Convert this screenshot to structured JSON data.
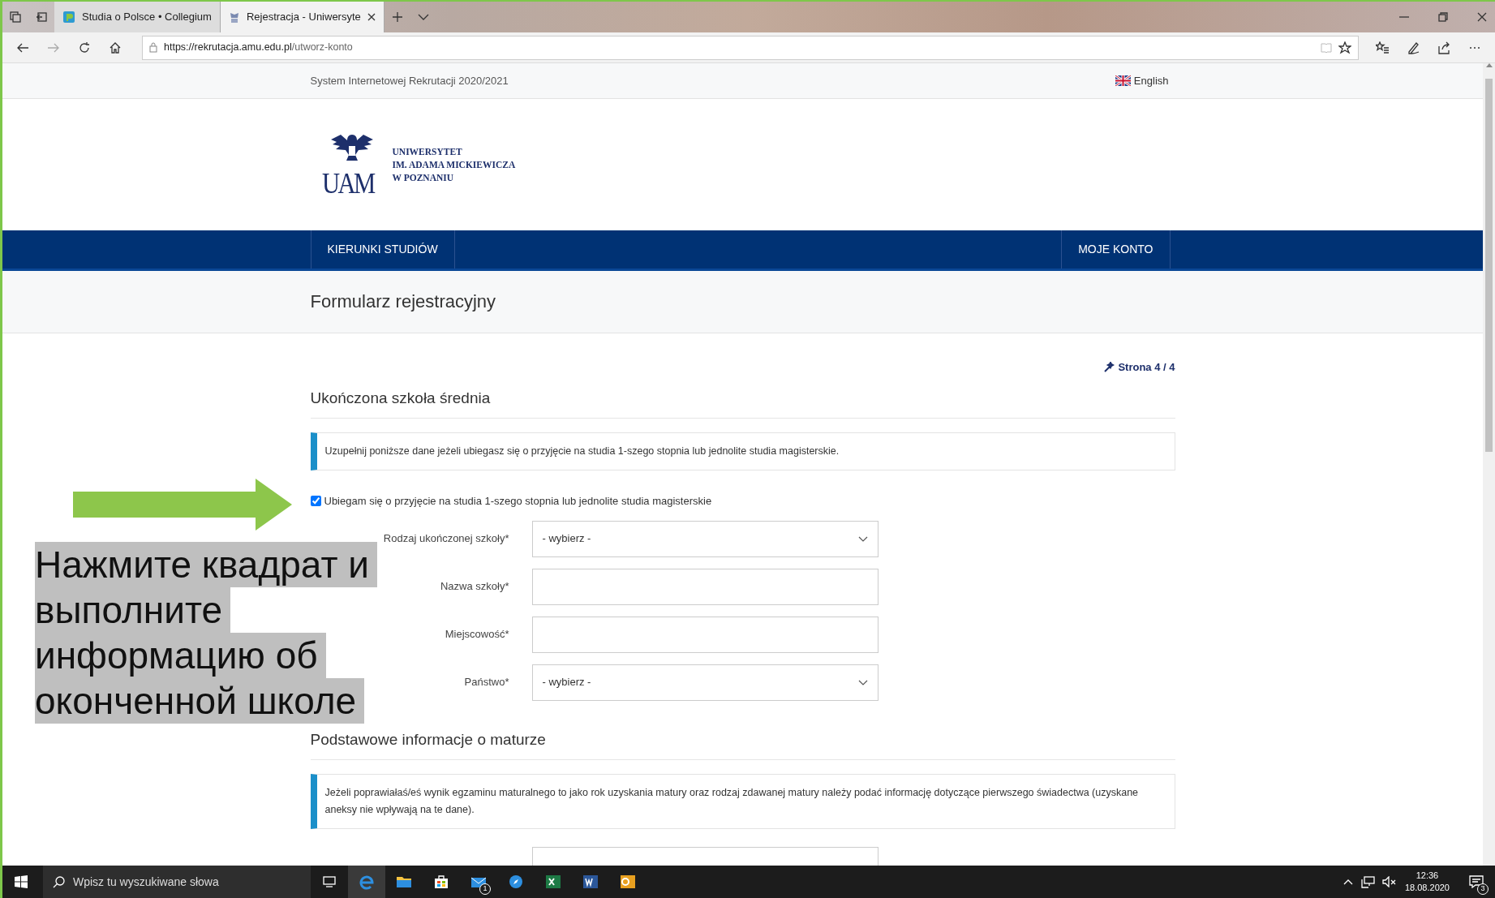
{
  "browser": {
    "tabs": [
      {
        "title": "Studia o Polsce • Collegium",
        "selected": false
      },
      {
        "title": "Rejestracja - Uniwersyte",
        "selected": true
      }
    ],
    "address": {
      "host": "https://rekrutacja.amu.edu.pl",
      "path": "/utworz-konto"
    }
  },
  "top_bar": {
    "system_name": "System Internetowej Rekrutacji 2020/2021",
    "language": "English"
  },
  "logo": {
    "monogram": "UAM",
    "lines": [
      "UNIWERSYTET",
      "IM. ADAMA MICKIEWICZA",
      "W POZNANIU"
    ]
  },
  "nav": [
    {
      "label": "KIERUNKI STUDIÓW"
    },
    {
      "label": "MOJE KONTO"
    }
  ],
  "page_title": "Formularz rejestracyjny",
  "step": "Strona 4 / 4",
  "sections": [
    {
      "heading": "Ukończona szkoła średnia",
      "info": "Uzupełnij poniższe dane jeżeli ubiegasz się o przyjęcie na studia 1-szego stopnia lub jednolite studia magisterskie.",
      "checkbox": {
        "label": "Ubiegam się o przyjęcie na studia 1-szego stopnia lub jednolite studia magisterskie",
        "checked": true
      },
      "fields": [
        {
          "label": "Rodzaj ukończonej szkoły*",
          "kind": "select",
          "value": "- wybierz -"
        },
        {
          "label": "Nazwa szkoły*",
          "kind": "text"
        },
        {
          "label": "Miejscowość*",
          "kind": "text"
        },
        {
          "label": "Państwo*",
          "kind": "select",
          "value": "- wybierz -"
        }
      ]
    },
    {
      "heading": "Podstawowe informacje o maturze",
      "info": "Jeżeli poprawiałaś/eś wynik egzaminu maturalnego to jako rok uzyskania matury oraz rodzaj zdawanej matury należy podać informację dotyczące pierwszego świadectwa (uzyskane aneksy nie wpływają na te dane).",
      "fields": [
        {
          "kind": "text"
        }
      ]
    }
  ],
  "annotation": {
    "lines": [
      "Нажмите квадрат и",
      "выполните",
      "информацию об",
      "оконченной школе"
    ]
  },
  "taskbar": {
    "search_placeholder": "Wpisz tu wyszukiwane słowa",
    "mail_badge": "1",
    "time": "12:36",
    "date": "18.08.2020",
    "notification_count": "3"
  }
}
